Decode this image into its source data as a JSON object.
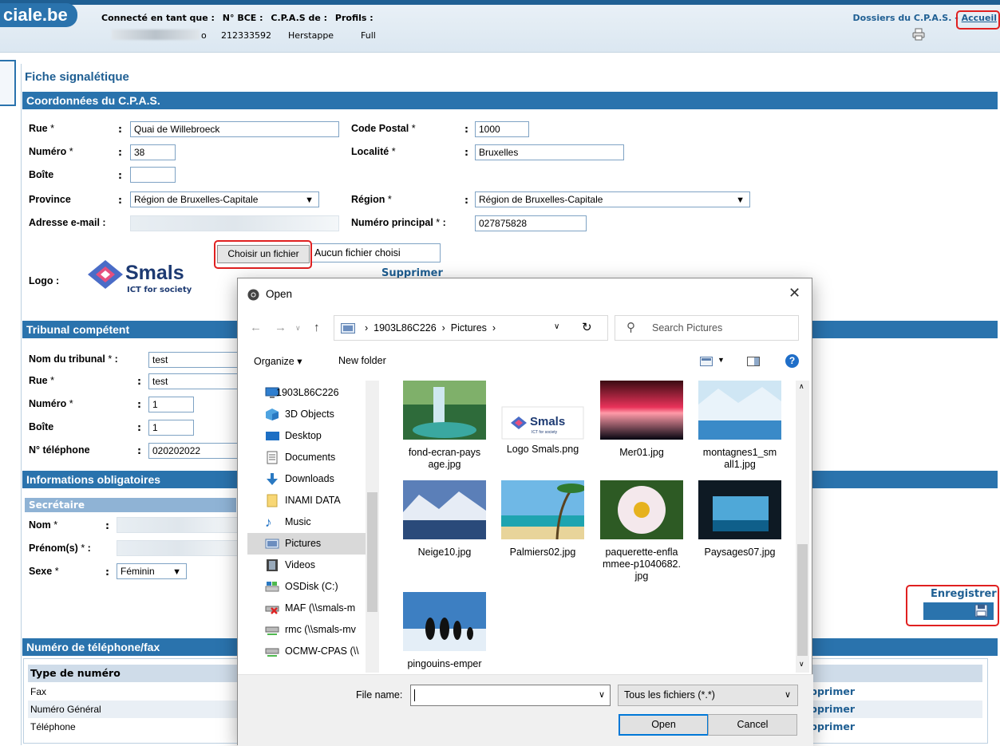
{
  "header": {
    "brand": "ciale.be",
    "labels": [
      "Connecté en tant que :",
      "N° BCE :",
      "C.P.A.S de :",
      "Profils :"
    ],
    "bce": "212333592",
    "cpas": "Herstappe",
    "profile": "Full",
    "user_suffix": "o",
    "dossiers_link": "Dossiers du C.P.A.S.",
    "separator": " - ",
    "accueil_link": "Accueil"
  },
  "page": {
    "title": "Fiche signalétique"
  },
  "coords": {
    "section_title": "Coordonnées du C.P.A.S.",
    "rue_label": "Rue",
    "rue_value": "Quai de Willebroeck",
    "numero_label": "Numéro",
    "numero_value": "38",
    "boite_label": "Boîte",
    "boite_value": "",
    "province_label": "Province",
    "province_value": "Région de Bruxelles-Capitale",
    "email_label": "Adresse e-mail :",
    "code_postal_label": "Code Postal",
    "code_postal_value": "1000",
    "localite_label": "Localité",
    "localite_value": "Bruxelles",
    "region_label": "Région",
    "region_value": "Région de Bruxelles-Capitale",
    "numero_principal_label": "Numéro principal",
    "numero_principal_value": "027875828",
    "logo_label": "Logo :",
    "file_button": "Choisir un fichier",
    "file_status": "Aucun fichier choisi",
    "supprimer": "Supprimer",
    "logo_brand": "Smals",
    "logo_tagline": "ICT for society"
  },
  "tribunal": {
    "section_title": "Tribunal compétent",
    "nom_label": "Nom du tribunal",
    "nom_value": "test",
    "rue_label": "Rue",
    "rue_value": "test",
    "numero_label": "Numéro",
    "numero_value": "1",
    "boite_label": "Boîte",
    "boite_value": "1",
    "telephone_label": "N° téléphone",
    "telephone_value": "020202022"
  },
  "infos": {
    "section_title": "Informations obligatoires",
    "sub_title": "Secrétaire",
    "nom_label": "Nom",
    "prenom_label": "Prénom(s)",
    "sexe_label": "Sexe",
    "sexe_value": "Féminin",
    "enregistrer": "Enregistrer"
  },
  "phones": {
    "section_title": "Numéro de téléphone/fax",
    "column_header": "Type de numéro",
    "rows": [
      "Fax",
      "Numéro Général",
      "Téléphone"
    ],
    "row_action": "pprimer"
  },
  "required_marker": "*",
  "colon": ":",
  "dialog": {
    "title": "Open",
    "close": "✕",
    "breadcrumb": [
      "1903L86C226",
      "Pictures"
    ],
    "search_placeholder": "Search Pictures",
    "organize": "Organize ▾",
    "new_folder": "New folder",
    "nav_items": [
      {
        "label": "1903L86C226",
        "icon": "computer-icon"
      },
      {
        "label": "3D Objects",
        "icon": "cube-icon"
      },
      {
        "label": "Desktop",
        "icon": "desktop-icon"
      },
      {
        "label": "Documents",
        "icon": "document-icon"
      },
      {
        "label": "Downloads",
        "icon": "download-icon"
      },
      {
        "label": "INAMI DATA",
        "icon": "folder-icon"
      },
      {
        "label": "Music",
        "icon": "music-icon"
      },
      {
        "label": "Pictures",
        "icon": "pictures-icon"
      },
      {
        "label": "Videos",
        "icon": "video-icon"
      },
      {
        "label": "OSDisk (C:)",
        "icon": "disk-icon"
      },
      {
        "label": "MAF (\\\\smals-m",
        "icon": "network-drive-error-icon"
      },
      {
        "label": "rmc (\\\\smals-mv",
        "icon": "network-drive-icon"
      },
      {
        "label": "OCMW-CPAS (\\\\",
        "icon": "network-drive-icon"
      }
    ],
    "files": [
      {
        "name": "fond-ecran-paysage.jpg",
        "line1": "fond-ecran-pays",
        "line2": "age.jpg",
        "line3": ""
      },
      {
        "name": "Logo Smals.png",
        "line1": "Logo Smals.png",
        "line2": "",
        "line3": ""
      },
      {
        "name": "Mer01.jpg",
        "line1": "Mer01.jpg",
        "line2": "",
        "line3": ""
      },
      {
        "name": "montagnes1_small1.jpg",
        "line1": "montagnes1_sm",
        "line2": "all1.jpg",
        "line3": ""
      },
      {
        "name": "Neige10.jpg",
        "line1": "Neige10.jpg",
        "line2": "",
        "line3": ""
      },
      {
        "name": "Palmiers02.jpg",
        "line1": "Palmiers02.jpg",
        "line2": "",
        "line3": ""
      },
      {
        "name": "paquerette-enflammee-p1040682.jpg",
        "line1": "paquerette-enfla",
        "line2": "mmee-p1040682.",
        "line3": "jpg"
      },
      {
        "name": "Paysages07.jpg",
        "line1": "Paysages07.jpg",
        "line2": "",
        "line3": ""
      },
      {
        "name": "pingouins-emper",
        "line1": "pingouins-emper",
        "line2": "",
        "line3": ""
      }
    ],
    "file_name_label": "File name:",
    "file_name_value": "",
    "filter": "Tous les fichiers (*.*)",
    "open_button": "Open",
    "cancel_button": "Cancel"
  },
  "colors": {
    "brand_blue": "#2a73ad",
    "link_blue": "#1f5f93",
    "highlight_red": "#e02020",
    "dialog_primary": "#0078d7"
  }
}
